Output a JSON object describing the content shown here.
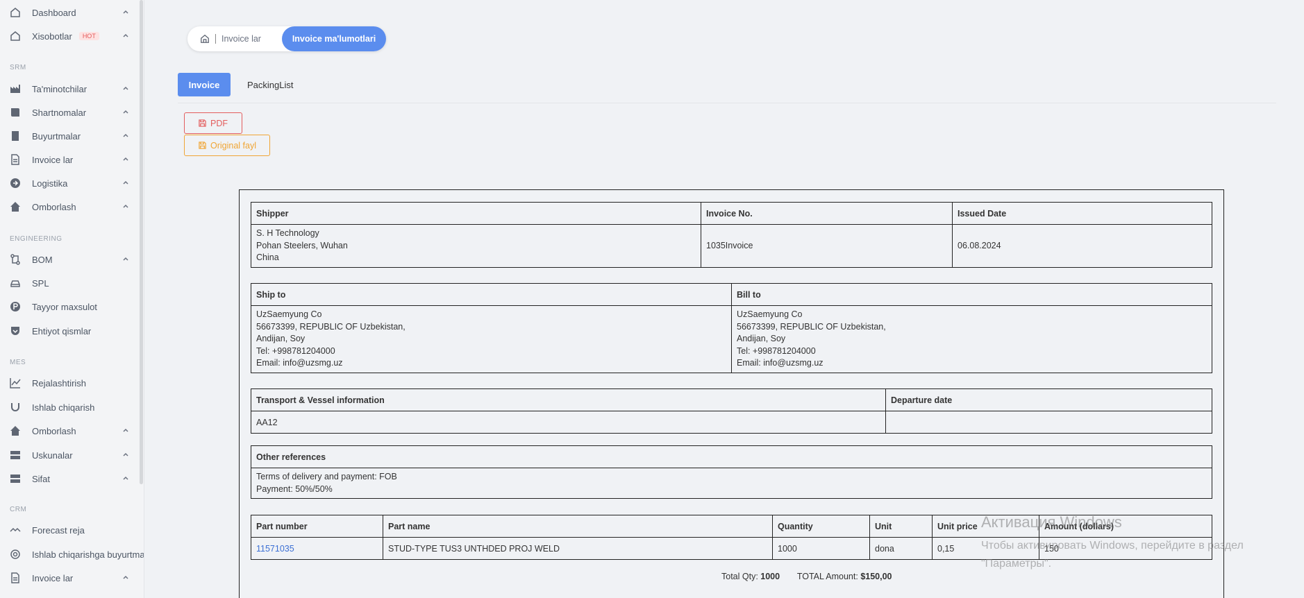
{
  "sidebar": {
    "items": [
      {
        "label": "Dashboard"
      },
      {
        "label": "Xisobotlar",
        "badge": "HOT"
      },
      {
        "label": "Ta'minotchilar"
      },
      {
        "label": "Shartnomalar"
      },
      {
        "label": "Buyurtmalar"
      },
      {
        "label": "Invoice lar"
      },
      {
        "label": "Logistika"
      },
      {
        "label": "Omborlash"
      },
      {
        "label": "BOM"
      },
      {
        "label": "SPL"
      },
      {
        "label": "Tayyor maxsulot"
      },
      {
        "label": "Ehtiyot qismlar"
      },
      {
        "label": "Rejalashtirish"
      },
      {
        "label": "Ishlab chiqarish"
      },
      {
        "label": "Omborlash"
      },
      {
        "label": "Uskunalar"
      },
      {
        "label": "Sifat"
      },
      {
        "label": "Forecast reja"
      },
      {
        "label": "Ishlab chiqarishga buyurtma"
      },
      {
        "label": "Invoice lar"
      }
    ],
    "sections": [
      "SRM",
      "ENGINEERING",
      "MES",
      "CRM"
    ]
  },
  "breadcrumb": {
    "parent": "Invoice lar",
    "current": "Invoice ma'lumotlari"
  },
  "tabs": [
    "Invoice",
    "PackingList"
  ],
  "buttons": {
    "pdf": "PDF",
    "original": "Original fayl"
  },
  "invoice": {
    "shipper_header": "Shipper",
    "invoice_no_header": "Invoice No.",
    "issued_date_header": "Issued Date",
    "shipper_lines": [
      "S. H Technology",
      "Pohan Steelers, Wuhan",
      "China"
    ],
    "invoice_no": "1035Invoice",
    "issued_date": "06.08.2024",
    "ship_to_header": "Ship to",
    "bill_to_header": "Bill to",
    "ship_to_lines": [
      "UzSaemyung Co",
      "56673399, REPUBLIC OF Uzbekistan,",
      "Andijan, Soy",
      "Tel: +998781204000",
      "Email: info@uzsmg.uz"
    ],
    "bill_to_lines": [
      "UzSaemyung Co",
      "56673399, REPUBLIC OF Uzbekistan,",
      "Andijan, Soy",
      "Tel: +998781204000",
      "Email: info@uzsmg.uz"
    ],
    "transport_header": "Transport & Vessel information",
    "departure_header": "Departure date",
    "transport_value": "AA12",
    "departure_value": "",
    "other_header": "Other references",
    "other_lines": [
      "Terms of delivery and payment: FOB",
      "Payment: 50%/50%"
    ],
    "items_headers": [
      "Part number",
      "Part name",
      "Quantity",
      "Unit",
      "Unit price",
      "Amount (dollars)"
    ],
    "items": [
      {
        "part_number": "11571035",
        "part_name": "STUD-TYPE TUS3 UNTHDED PROJ WELD",
        "quantity": "1000",
        "unit": "dona",
        "unit_price": "0,15",
        "amount": "150"
      }
    ],
    "total_qty_label": "Total Qty:",
    "total_qty": "1000",
    "total_amount_label": "TOTAL Amount:",
    "total_amount": "$150,00"
  },
  "watermark": {
    "title": "Активация Windows",
    "text": "Чтобы активировать Windows, перейдите в раздел \"Параметры\"."
  }
}
